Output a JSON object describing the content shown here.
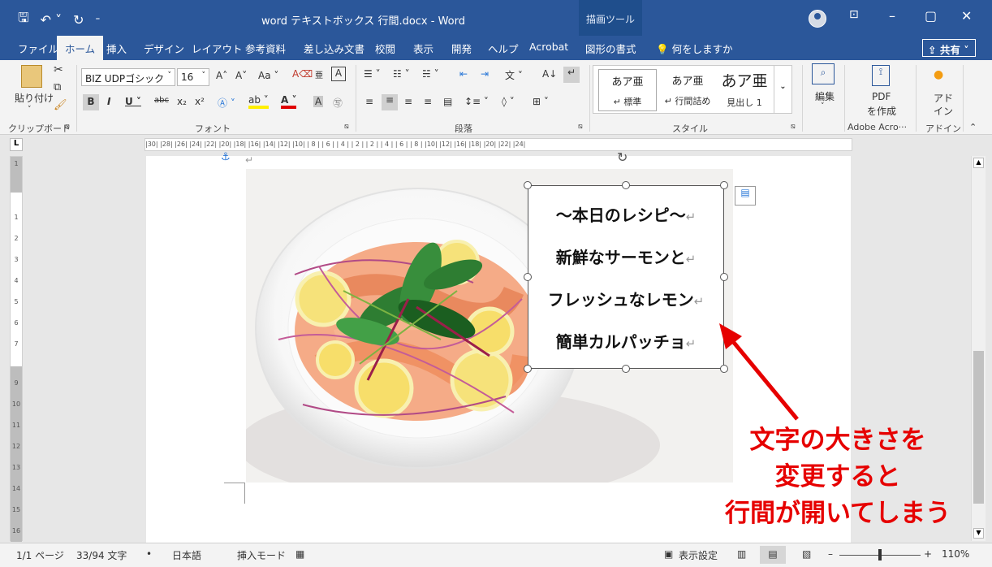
{
  "titlebar": {
    "title": "word テキストボックス 行間.docx  -  Word",
    "context_tool": "描画ツール",
    "minimize": "–",
    "maximize": "▢",
    "close": "✕"
  },
  "tabs": [
    "ファイル",
    "ホーム",
    "挿入",
    "デザイン",
    "レイアウト",
    "参考資料",
    "差し込み文書",
    "校閲",
    "表示",
    "開発",
    "ヘルプ",
    "Acrobat",
    "図形の書式"
  ],
  "tell_me": "何をしますか",
  "share": "共有",
  "ribbon": {
    "clipboard": {
      "paste": "貼り付け",
      "label": "クリップボード"
    },
    "font": {
      "name": "BIZ UDPゴシック",
      "size": "16",
      "label": "フォント"
    },
    "paragraph": {
      "label": "段落"
    },
    "styles": {
      "label": "スタイル",
      "items": [
        {
          "sample": "あア亜",
          "name": "↵ 標準"
        },
        {
          "sample": "あア亜",
          "name": "↵ 行間詰め"
        },
        {
          "sample": "あア亜",
          "name": "見出し 1"
        }
      ]
    },
    "editing": {
      "label": "編集"
    },
    "pdf": {
      "line1": "PDF",
      "line2": "を作成",
      "group": "Adobe Acro···"
    },
    "addin": {
      "line1": "アド",
      "line2": "イン",
      "group": "アドイン"
    }
  },
  "ruler_text": "|30| |28| |26| |24| |22| |20| |18| |16| |14| |12| |10| | 8 | | 6 | | 4 | | 2 |    | 2 | | 4 | | 6 | | 8 | |10| |12|   |16| |18| |20| |22| |24|",
  "textbox": {
    "lines": [
      "～本日のレシピ～",
      "新鮮なサーモンと",
      "フレッシュなレモン",
      "簡単カルパッチョ"
    ],
    "return_mark": "↵"
  },
  "annotation": {
    "lines": [
      "文字の大きさを",
      "変更すると",
      "行間が開いてしまう"
    ],
    "color": "#e60000"
  },
  "status": {
    "page": "1/1 ページ",
    "words": "33/94 文字",
    "language": "日本語",
    "mode": "挿入モード",
    "display": "表示設定",
    "zoom": "110%"
  }
}
